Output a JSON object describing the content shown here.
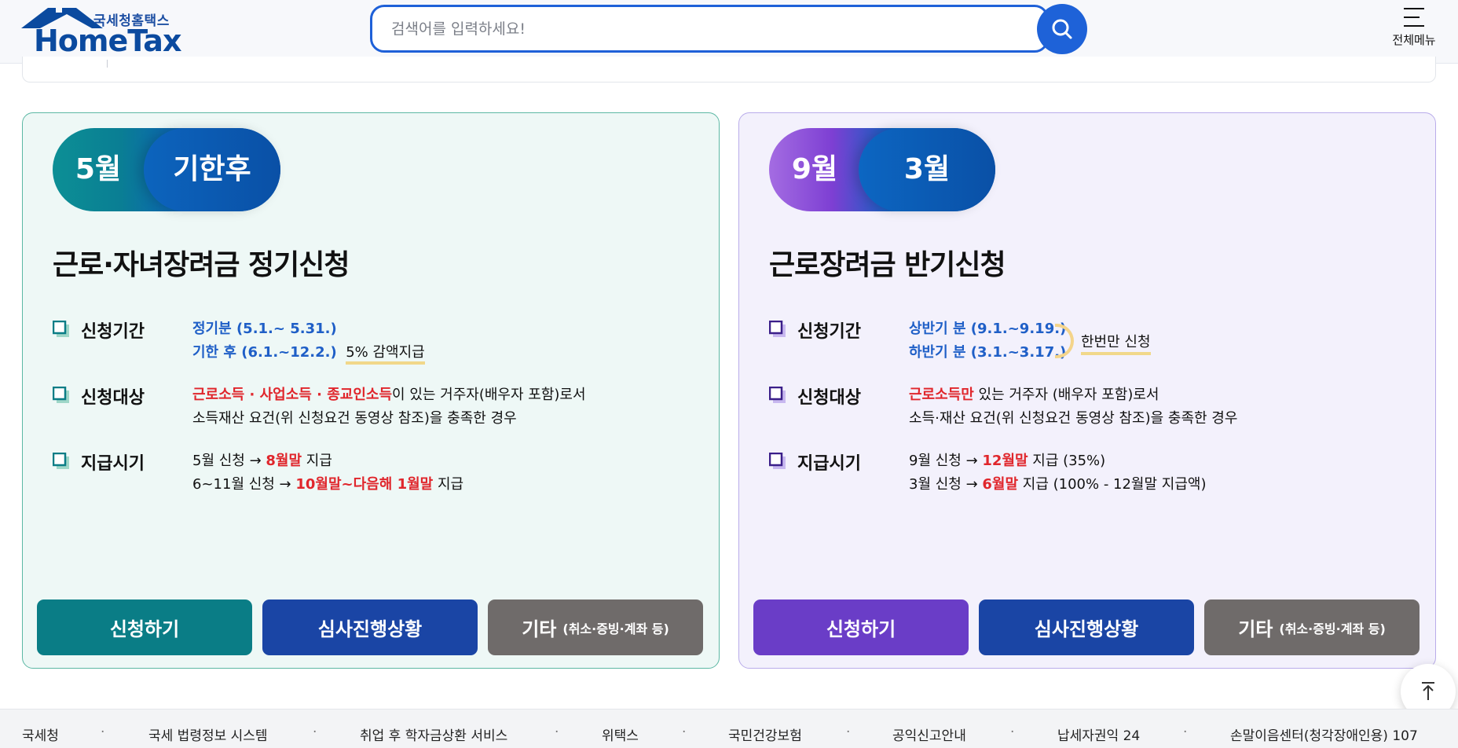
{
  "header": {
    "logo_sub": "국세청홈택스",
    "logo_main": "HomeTax",
    "search_placeholder": "검색어를 입력하세요!",
    "menu_label": "전체메뉴"
  },
  "cards": [
    {
      "pill_left": "5월",
      "pill_right": "기한후",
      "title": "근로·자녀장려금 정기신청",
      "rows": [
        {
          "label": "신청기간",
          "lines": [
            {
              "a": "정기분 (5.1.~ 5.31.)"
            },
            {
              "a": "기한 후 (6.1.~12.2.)",
              "b": "5% 감액지급"
            }
          ]
        },
        {
          "label": "신청대상",
          "lines": [
            {
              "red": "근로소득 · 사업소득 · 종교인소득",
              "rest": "이 있는 거주자(배우자 포함)로서"
            },
            {
              "rest": "소득재산 요건(위 신청요건 동영상 참조)을 충족한 경우"
            }
          ]
        },
        {
          "label": "지급시기",
          "lines": [
            {
              "pre": "5월 신청 → ",
              "red": "8월말",
              "rest": " 지급"
            },
            {
              "pre": "6~11월 신청 → ",
              "red": "10월말~다음해 1월말",
              "rest": " 지급"
            }
          ]
        }
      ],
      "buttons": {
        "apply": "신청하기",
        "status": "심사진행상황",
        "etc": "기타",
        "etc_small": "(취소·증빙·계좌 등)"
      }
    },
    {
      "pill_left": "9월",
      "pill_right": "3월",
      "title": "근로장려금 반기신청",
      "rows": [
        {
          "label": "신청기간",
          "lines": [
            {
              "a": "상반기 분 (9.1.~9.19.)"
            },
            {
              "a": "하반기 분 (3.1.~3.17.)"
            }
          ],
          "note": "한번만 신청"
        },
        {
          "label": "신청대상",
          "lines": [
            {
              "red": "근로소득만",
              "rest": " 있는 거주자 (배우자 포함)로서"
            },
            {
              "rest": "소득·재산 요건(위 신청요건 동영상 참조)을 충족한 경우"
            }
          ]
        },
        {
          "label": "지급시기",
          "lines": [
            {
              "pre": "9월 신청 → ",
              "red": "12월말",
              "rest": " 지급 (35%)"
            },
            {
              "pre": "3월 신청 → ",
              "red": "6월말",
              "rest": " 지급 (100% - 12월말 지급액)"
            }
          ]
        }
      ],
      "buttons": {
        "apply": "신청하기",
        "status": "심사진행상황",
        "etc": "기타",
        "etc_small": "(취소·증빙·계좌 등)"
      }
    }
  ],
  "footer": {
    "links": [
      "국세청",
      "국세 법령정보 시스템",
      "취업 후 학자금상환 서비스",
      "위택스",
      "국민건강보험",
      "공익신고안내",
      "납세자권익 24",
      "손말이음센터(청각장애인용) 107"
    ],
    "separator": "·"
  },
  "colors": {
    "teal": "#0a7d86",
    "purple": "#6a3dc7",
    "navy": "#1a45a5",
    "gray": "#6f6b6a",
    "accent_blue": "#1f5fc7",
    "accent_red": "#e0262c"
  },
  "icons": [
    "search-icon",
    "hamburger-menu-icon",
    "checkbox-square-icon",
    "arrow-up-icon"
  ]
}
